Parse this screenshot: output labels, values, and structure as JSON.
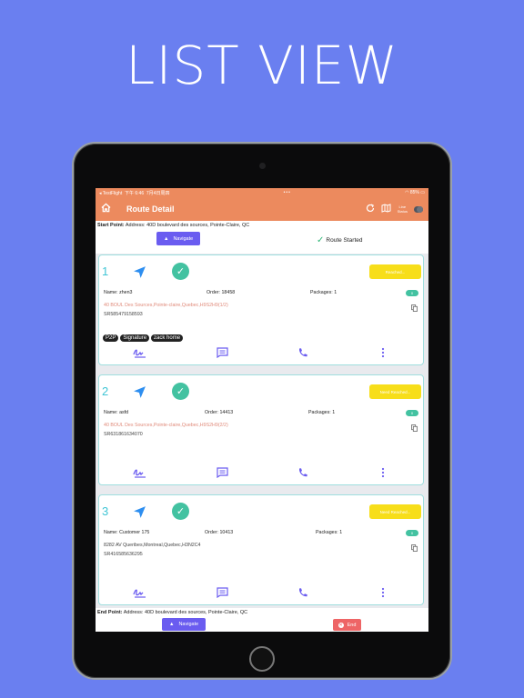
{
  "headline": "LIST VIEW",
  "status_bar": {
    "carrier": "◂ TestFlight",
    "time": "下午 6:46",
    "date": "7月4日周四",
    "dots": "•••",
    "battery": "85%"
  },
  "app_bar": {
    "title": "Route Detail",
    "toggle_label_1": "Line",
    "toggle_label_2": "Status"
  },
  "start": {
    "label": "Start Point:",
    "address": "Address: 40D boulevard des sources, Pointe-Claire, QC",
    "navigate": "Navigate",
    "status": "Route Started"
  },
  "stops": [
    {
      "number": "1",
      "reach_label": "Reached...",
      "name": "Name: zhen3",
      "order": "Order: 18458",
      "packages": "Packages: 1",
      "pill": "0",
      "address": "40 BOUL Des Sources,Pointe-claire,Quebec,H9S2H9(1/2)",
      "address_style": "red",
      "sr": "SR585479158593",
      "tags": [
        "P2P",
        "Signature",
        "zack home"
      ]
    },
    {
      "number": "2",
      "reach_label": "Need Reached...",
      "name": "Name: asfd",
      "order": "Order: 14413",
      "packages": "Packages: 1",
      "pill": "0",
      "address": "40 BOUL Des Sources,Pointe-claire,Quebec,H9S2H9(2/2)",
      "address_style": "red",
      "sr": "SR631861634070",
      "tags": []
    },
    {
      "number": "3",
      "reach_label": "Need Reached...",
      "name": "Name: Customer 175",
      "order": "Order: 10413",
      "packages": "Packages: 1",
      "pill": "0",
      "address": "8282 AV Queribes,Montreal,Quebec,H3N2C4",
      "address_style": "dark",
      "sr": "SR416585636295",
      "tags": []
    }
  ],
  "end": {
    "label": "End Point:",
    "address": "Address: 40D boulevard des sources, Pointe-Claire, QC",
    "navigate": "Navigate",
    "end_label": "End"
  },
  "colors": {
    "background": "#6a7ff0",
    "app_bar": "#ec8a5e",
    "accent": "#6a5cf0",
    "teal": "#43c2a1",
    "yellow": "#f7de1a",
    "end_red": "#ee6566"
  }
}
